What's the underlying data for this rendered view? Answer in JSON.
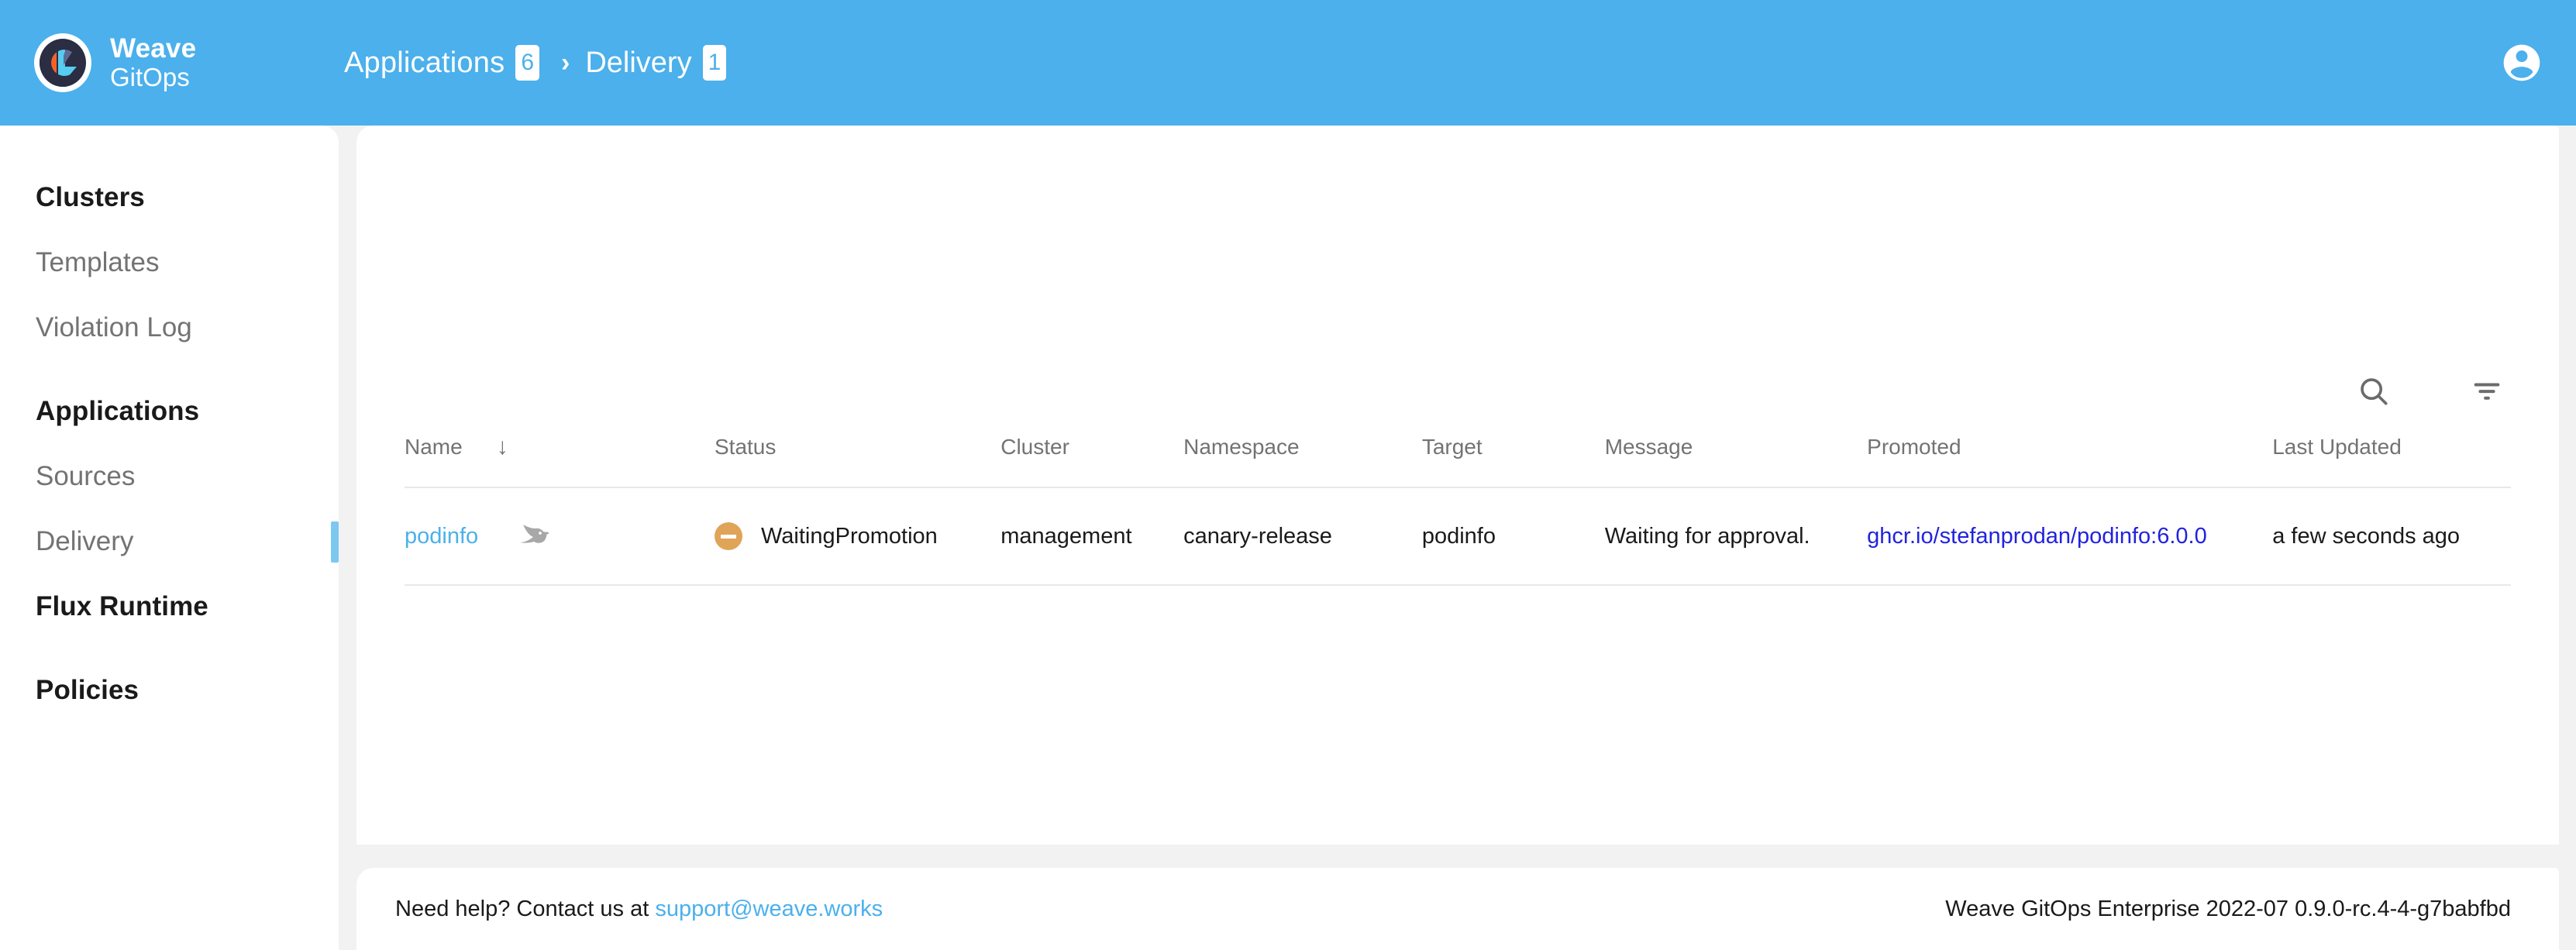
{
  "header": {
    "brand_line1": "Weave",
    "brand_line2": "GitOps",
    "logo_icon": "weave-gitops-logo",
    "avatar_icon": "account-circle-icon",
    "accent_color": "#4bb0ec",
    "breadcrumb": {
      "parent_label": "Applications",
      "parent_count": "6",
      "separator": "›",
      "current_label": "Delivery",
      "current_count": "1"
    }
  },
  "sidebar": {
    "items": [
      {
        "label": "Clusters",
        "level": "primary",
        "active": false
      },
      {
        "label": "Templates",
        "level": "sub",
        "active": false
      },
      {
        "label": "Violation Log",
        "level": "sub",
        "active": false
      },
      {
        "label": "Applications",
        "level": "primary",
        "active": false
      },
      {
        "label": "Sources",
        "level": "sub",
        "active": false
      },
      {
        "label": "Delivery",
        "level": "sub",
        "active": true
      },
      {
        "label": "Flux Runtime",
        "level": "primary",
        "active": false
      },
      {
        "label": "Policies",
        "level": "primary",
        "active": false
      }
    ],
    "active_indicator_color": "#7cc8f0"
  },
  "main": {
    "tools": {
      "search_icon": "search-icon",
      "filter_icon": "filter-list-icon"
    },
    "table": {
      "sort_indicator": "↓",
      "columns": [
        "Name",
        "Status",
        "Cluster",
        "Namespace",
        "Target",
        "Message",
        "Promoted",
        "Last Updated"
      ],
      "rows": [
        {
          "name": "podinfo",
          "type_icon": "flagger-bird-icon",
          "status_icon": "minus-circle-icon",
          "status_color": "#e0a458",
          "status": "WaitingPromotion",
          "cluster": "management",
          "namespace": "canary-release",
          "target": "podinfo",
          "message": "Waiting for approval.",
          "promoted": "ghcr.io/stefanprodan/podinfo:6.0.0",
          "last_updated": "a few seconds ago"
        }
      ]
    }
  },
  "footer": {
    "help_prefix": "Need help? Contact us at",
    "help_email": "support@weave.works",
    "version": "Weave GitOps Enterprise 2022-07 0.9.0-rc.4-4-g7babfbd"
  }
}
